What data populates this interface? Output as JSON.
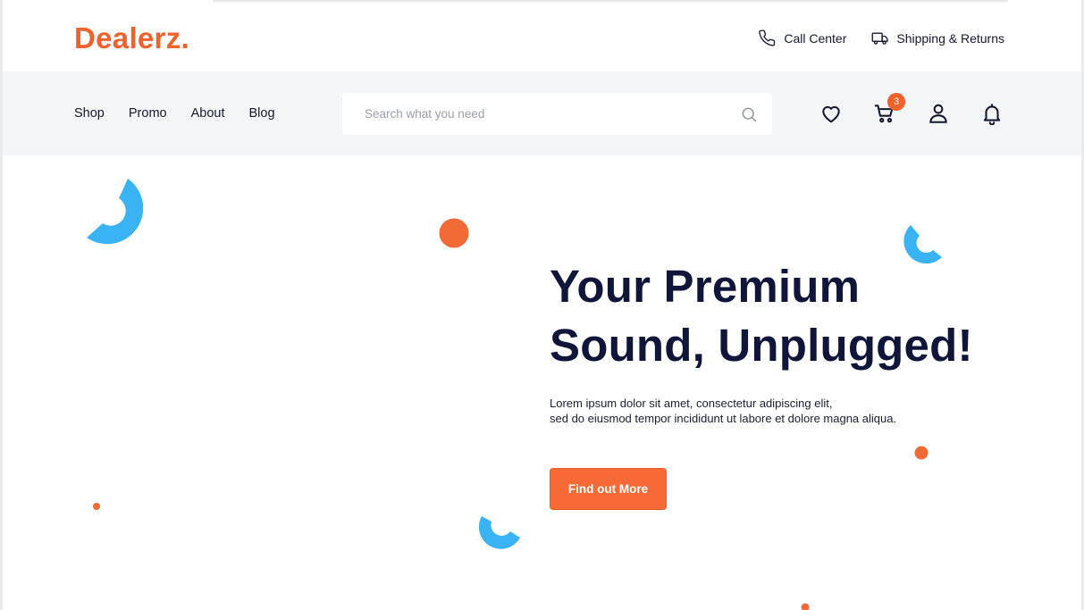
{
  "brand": {
    "logo_text": "Dealerz.",
    "accent_color": "#f0622c",
    "deco_blue": "#3ab3f5"
  },
  "top_links": [
    {
      "label": "Call Center",
      "icon": "phone-icon"
    },
    {
      "label": "Shipping & Returns",
      "icon": "truck-icon"
    }
  ],
  "nav": {
    "items": [
      {
        "label": "Shop"
      },
      {
        "label": "Promo"
      },
      {
        "label": "About"
      },
      {
        "label": "Blog"
      }
    ]
  },
  "search": {
    "placeholder": "Search what you need",
    "value": "",
    "icon": "search-icon"
  },
  "icons": {
    "wishlist": "heart-icon",
    "cart": "cart-icon",
    "cart_count": "3",
    "account": "user-icon",
    "notifications": "bell-icon"
  },
  "hero": {
    "title_line1": "Your Premium",
    "title_line2": "Sound, Unplugged!",
    "desc_line1": "Lorem ipsum dolor sit amet, consectetur adipiscing elit,",
    "desc_line2": "sed do eiusmod tempor incididunt ut labore et dolore magna aliqua.",
    "cta_label": "Find out More"
  }
}
